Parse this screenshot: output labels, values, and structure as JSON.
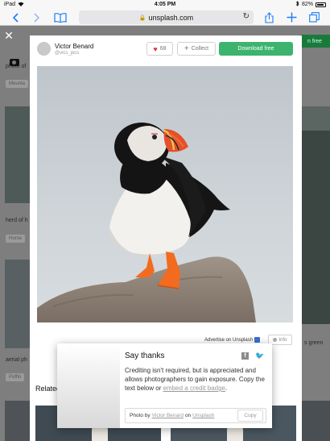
{
  "status_bar": {
    "device": "iPad",
    "time": "4:05 PM",
    "battery": "82%"
  },
  "browser": {
    "url": "unsplash.com",
    "icons": [
      "back-icon",
      "forward-icon",
      "bookmarks-icon",
      "lock-icon",
      "reload-icon",
      "share-icon",
      "new-tab-icon",
      "tabs-icon"
    ]
  },
  "background_page": {
    "texts": [
      "photo of",
      "Mounta",
      "herd of h",
      "Horse",
      "aerial ph",
      "Puffin",
      "s green",
      "n free"
    ]
  },
  "photo_header": {
    "author_name": "Victor Benard",
    "author_handle": "@vics_pics",
    "like_count": "68",
    "collect_label": "Collect",
    "download_label": "Download free"
  },
  "photo_footer": {
    "advertise_label": "Advertise on Unsplash",
    "info_label": "Info"
  },
  "related": {
    "title": "Related"
  },
  "say_thanks": {
    "title": "Say thanks",
    "body_text": "Crediting isn't required, but is appreciated and allows photographers to gain exposure. Copy the text below or",
    "embed_link": "embed a credit badge",
    "body_end": ".",
    "credit_prefix": "Photo by",
    "credit_author": "Victor Benard",
    "credit_on": "on",
    "credit_site": "Unsplash",
    "copy_label": "Copy"
  },
  "colors": {
    "download_green": "#3cb46e",
    "heart_red": "#e0364a",
    "ios_blue": "#1a7cf5"
  }
}
